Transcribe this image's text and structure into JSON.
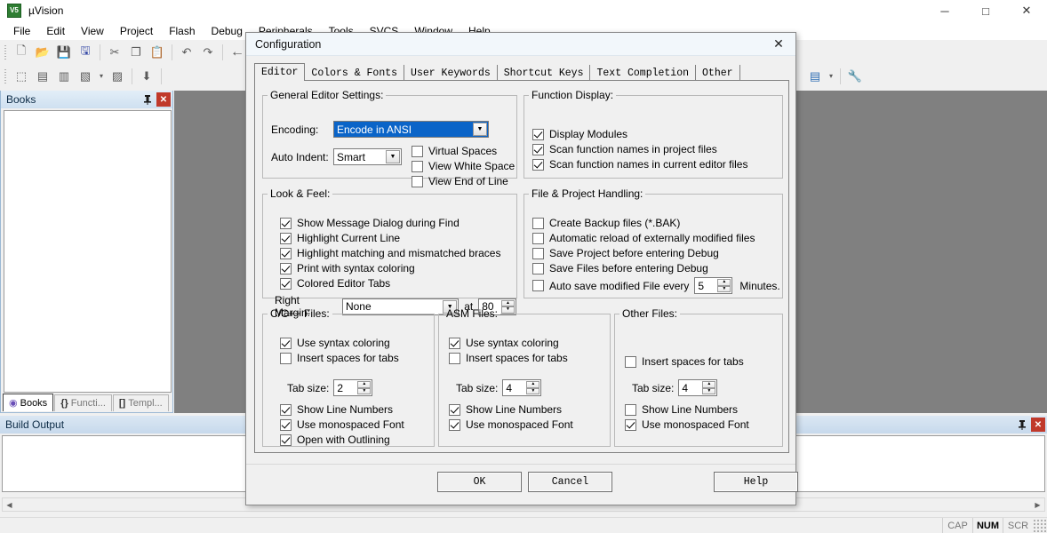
{
  "window": {
    "app_title": "µVision",
    "logo_text": "V5",
    "minimize": "─",
    "maximize": "□",
    "close": "✕"
  },
  "menubar": {
    "items": [
      "File",
      "Edit",
      "View",
      "Project",
      "Flash",
      "Debug",
      "Peripherals",
      "Tools",
      "SVCS",
      "Window",
      "Help"
    ]
  },
  "toolbar_row1": {
    "icons": [
      {
        "name": "new-file-icon",
        "glyph": "🗋"
      },
      {
        "name": "open-file-icon",
        "glyph": "📂"
      },
      {
        "name": "save-icon",
        "glyph": "💾"
      },
      {
        "name": "save-all-icon",
        "glyph": "🖫"
      },
      {
        "name": "cut-icon",
        "glyph": "✂"
      },
      {
        "name": "copy-icon",
        "glyph": "❐"
      },
      {
        "name": "paste-icon",
        "glyph": "📋"
      },
      {
        "name": "undo-icon",
        "glyph": "↶"
      },
      {
        "name": "redo-icon",
        "glyph": "↷"
      },
      {
        "name": "navigate-back-icon",
        "glyph": "←"
      }
    ]
  },
  "toolbar_row2": {
    "icons": [
      {
        "name": "translate-icon",
        "glyph": "⬚"
      },
      {
        "name": "build-icon",
        "glyph": "▤"
      },
      {
        "name": "rebuild-icon",
        "glyph": "▥"
      },
      {
        "name": "batch-build-icon",
        "glyph": "▧"
      },
      {
        "name": "batch-build-dropdown-icon",
        "glyph": "▾"
      },
      {
        "name": "stop-build-icon",
        "glyph": "▨"
      },
      {
        "name": "load-icon",
        "glyph": "⬇"
      }
    ]
  },
  "toolbar_right": {
    "icons": [
      {
        "name": "target-options-icon",
        "glyph": "▤"
      },
      {
        "name": "target-dropdown-icon",
        "glyph": "▾"
      },
      {
        "name": "configure-wrench-icon",
        "glyph": "🔧"
      }
    ]
  },
  "books_panel": {
    "title": "Books",
    "pin_icon": "下",
    "close_icon": "✕",
    "tabs": [
      {
        "label": "Books",
        "icon": "◉",
        "active": true
      },
      {
        "label": "Functi...",
        "icon": "{}",
        "active": false
      },
      {
        "label": "Templ...",
        "icon": "[]",
        "active": false
      }
    ]
  },
  "build_output": {
    "title": "Build Output",
    "pin_icon": "下",
    "close_icon": "✕",
    "text": ""
  },
  "statusbar": {
    "message": "",
    "indicators": [
      {
        "label": "CAP",
        "active": false
      },
      {
        "label": "NUM",
        "active": true
      },
      {
        "label": "SCR",
        "active": false
      }
    ]
  },
  "dialog": {
    "title": "Configuration",
    "close_icon": "✕",
    "tabs": [
      {
        "label": "Editor",
        "active": true
      },
      {
        "label": "Colors & Fonts",
        "active": false
      },
      {
        "label": "User Keywords",
        "active": false
      },
      {
        "label": "Shortcut Keys",
        "active": false
      },
      {
        "label": "Text Completion",
        "active": false
      },
      {
        "label": "Other",
        "active": false
      }
    ],
    "general_editor_settings": {
      "legend": "General Editor Settings:",
      "encoding_label": "Encoding:",
      "encoding_value": "Encode in ANSI",
      "auto_indent_label": "Auto Indent:",
      "auto_indent_value": "Smart",
      "checkboxes": [
        {
          "label": "Virtual Spaces",
          "checked": false
        },
        {
          "label": "View White Space",
          "checked": false
        },
        {
          "label": "View End of Line",
          "checked": false
        }
      ]
    },
    "function_display": {
      "legend": "Function Display:",
      "checkboxes": [
        {
          "label": "Display Modules",
          "checked": true
        },
        {
          "label": "Scan function names in project files",
          "checked": true
        },
        {
          "label": "Scan function names in current editor files",
          "checked": true
        }
      ]
    },
    "look_and_feel": {
      "legend": "Look & Feel:",
      "checkboxes": [
        {
          "label": "Show Message Dialog during Find",
          "checked": true
        },
        {
          "label": "Highlight Current Line",
          "checked": true
        },
        {
          "label": "Highlight matching and mismatched braces",
          "checked": true
        },
        {
          "label": "Print with syntax coloring",
          "checked": true
        },
        {
          "label": "Colored Editor Tabs",
          "checked": true
        }
      ],
      "right_margin_label": "Right Margin:",
      "right_margin_value": "None",
      "at_label": "at",
      "at_value": "80"
    },
    "file_project_handling": {
      "legend": "File & Project Handling:",
      "checkboxes": [
        {
          "label": "Create Backup files (*.BAK)",
          "checked": false
        },
        {
          "label": "Automatic reload of externally modified files",
          "checked": false
        },
        {
          "label": "Save Project before entering Debug",
          "checked": false
        },
        {
          "label": "Save Files before entering Debug",
          "checked": false
        }
      ],
      "autosave_label": "Auto save modified File every",
      "autosave_checked": false,
      "autosave_value": "5",
      "minutes_label": "Minutes."
    },
    "c_cpp_files": {
      "legend": "C/C++ Files:",
      "syntax_coloring": {
        "label": "Use syntax coloring",
        "checked": true
      },
      "insert_spaces": {
        "label": "Insert spaces for tabs",
        "checked": false
      },
      "tab_size_label": "Tab size:",
      "tab_size_value": "2",
      "line_numbers": {
        "label": "Show Line Numbers",
        "checked": true
      },
      "monospaced": {
        "label": "Use monospaced Font",
        "checked": true
      },
      "outlining": {
        "label": "Open with Outlining",
        "checked": true
      }
    },
    "asm_files": {
      "legend": "ASM Files:",
      "syntax_coloring": {
        "label": "Use syntax coloring",
        "checked": true
      },
      "insert_spaces": {
        "label": "Insert spaces for tabs",
        "checked": false
      },
      "tab_size_label": "Tab size:",
      "tab_size_value": "4",
      "line_numbers": {
        "label": "Show Line Numbers",
        "checked": true
      },
      "monospaced": {
        "label": "Use monospaced Font",
        "checked": true
      }
    },
    "other_files": {
      "legend": "Other Files:",
      "insert_spaces": {
        "label": "Insert spaces for tabs",
        "checked": false
      },
      "tab_size_label": "Tab size:",
      "tab_size_value": "4",
      "line_numbers": {
        "label": "Show Line Numbers",
        "checked": false
      },
      "monospaced": {
        "label": "Use monospaced Font",
        "checked": true
      }
    },
    "buttons": {
      "ok": "OK",
      "cancel": "Cancel",
      "help": "Help"
    }
  },
  "colors": {
    "accent_selection": "#0a64c8",
    "panel_header": "#cfe0f0",
    "close_red": "#c0392b",
    "editor_background": "#808080"
  }
}
